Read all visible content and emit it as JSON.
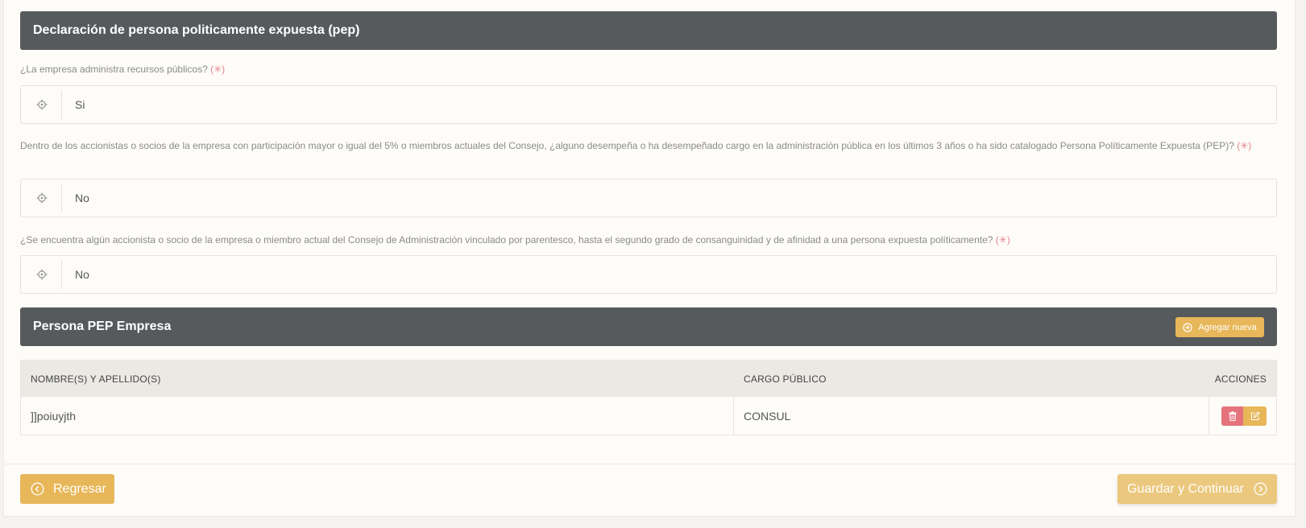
{
  "pep_section": {
    "title": "Declaración de persona politicamente expuesta (pep)"
  },
  "questions": [
    {
      "label": "¿La empresa administra recursos públicos?",
      "required_mark": "(✳)",
      "value": "Si",
      "icon": "target-icon"
    },
    {
      "label": "Dentro de los accionistas o socios de la empresa con participación mayor o igual del 5% o miembros actuales del Consejo, ¿alguno desempeña o ha desempeñado cargo en la administración pública en los últimos 3 años o ha sido catalogado Persona Políticamente Expuesta (PEP)?",
      "required_mark": "(✳)",
      "value": "No",
      "icon": "target-icon"
    },
    {
      "label": "¿Se encuentra algún accionista o socio de la empresa o miembro actual del Consejo de Administración vinculado por parentesco, hasta el segundo grado de consanguinidad y de afinidad a una persona expuesta políticamente?",
      "required_mark": "(✳)",
      "value": "No",
      "icon": "target-icon"
    }
  ],
  "persona_section": {
    "title": "Persona PEP Empresa",
    "add_label": "Agregar nueva"
  },
  "table": {
    "headers": [
      "NOMBRE(S) Y APELLIDO(S)",
      "CARGO PÚBLICO",
      "ACCIONES"
    ],
    "rows": [
      {
        "nombre": "]]poiuyjth",
        "cargo": "CONSUL"
      }
    ]
  },
  "footer": {
    "back_label": "Regresar",
    "next_label": "Guardar y Continuar"
  },
  "colors": {
    "header_bg": "#575a5d",
    "accent": "#e7b759",
    "danger": "#e6737c",
    "required": "#e8828d"
  }
}
